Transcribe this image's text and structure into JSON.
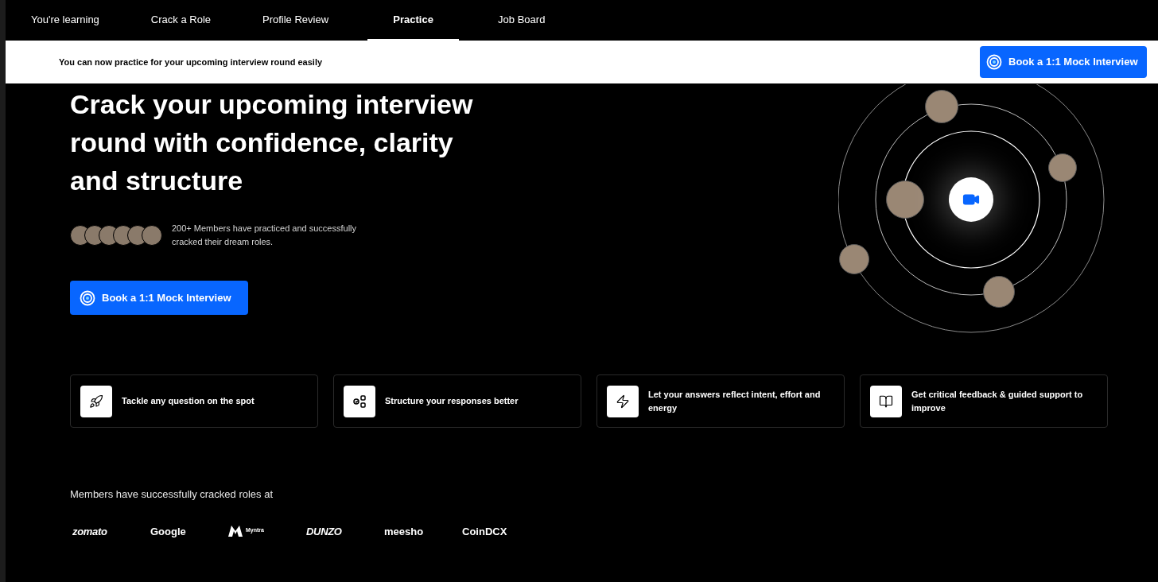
{
  "nav": {
    "tabs": [
      {
        "label": "You're learning",
        "selected": false
      },
      {
        "label": "Crack a Role",
        "selected": false
      },
      {
        "label": "Profile Review",
        "selected": false
      },
      {
        "label": "Practice",
        "selected": true
      },
      {
        "label": "Job Board",
        "selected": false
      }
    ]
  },
  "banner": {
    "text": "You can now practice for your upcoming interview round easily",
    "button": "Book a 1:1 Mock Interview"
  },
  "hero": {
    "title": "Crack your upcoming interview round with confidence, clarity and structure",
    "members_text": "200+ Members have practiced and successfully cracked their dream roles.",
    "button": "Book a 1:1 Mock Interview"
  },
  "features": [
    {
      "kind": "rocket",
      "text": "Tackle any question on the spot"
    },
    {
      "kind": "structure",
      "text": "Structure your responses better"
    },
    {
      "kind": "bolt",
      "text": "Let your answers reflect intent, effort and energy"
    },
    {
      "kind": "book",
      "text": "Get critical feedback & guided support to improve"
    }
  ],
  "companies": {
    "heading": "Members have successfully cracked roles at",
    "logos": [
      {
        "kind": "italic",
        "name": "zomato"
      },
      {
        "kind": "plain",
        "name": "Google"
      },
      {
        "kind": "icon",
        "name": "Myntra"
      },
      {
        "kind": "italic",
        "name": "DUNZO"
      },
      {
        "kind": "plain",
        "name": "meesho"
      },
      {
        "kind": "plain",
        "name": "CoinDCX"
      }
    ]
  }
}
